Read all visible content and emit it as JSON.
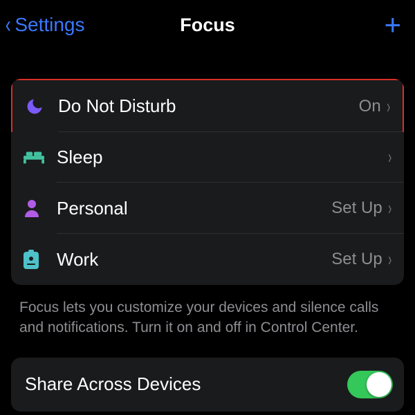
{
  "nav": {
    "back_label": "Settings",
    "title": "Focus"
  },
  "rows": [
    {
      "id": "do-not-disturb",
      "label": "Do Not Disturb",
      "status": "On"
    },
    {
      "id": "sleep",
      "label": "Sleep",
      "status": ""
    },
    {
      "id": "personal",
      "label": "Personal",
      "status": "Set Up"
    },
    {
      "id": "work",
      "label": "Work",
      "status": "Set Up"
    }
  ],
  "footer": "Focus lets you customize your devices and silence calls and notifications. Turn it on and off in Control Center.",
  "share": {
    "label": "Share Across Devices",
    "on": true
  }
}
